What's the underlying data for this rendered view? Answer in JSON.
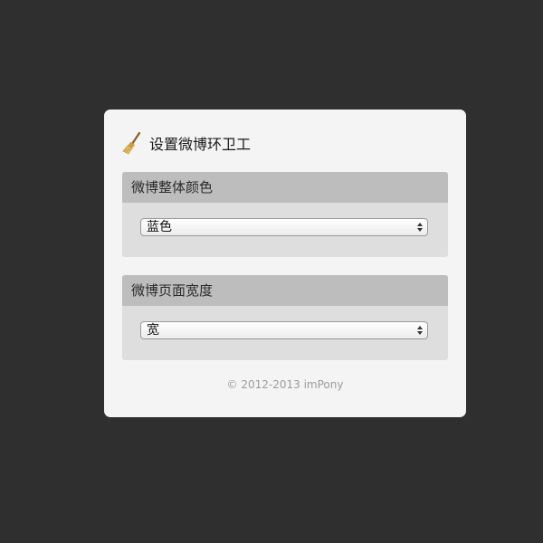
{
  "window": {
    "title": "设置微博环卫工",
    "icon": "broom-icon"
  },
  "sections": [
    {
      "heading": "微博整体颜色",
      "selected": "蓝色"
    },
    {
      "heading": "微博页面宽度",
      "selected": "宽"
    }
  ],
  "footer": {
    "copyright": "© 2012-2013 imPony"
  },
  "colors": {
    "background": "#2f2f2f",
    "dialog": "#f4f4f4",
    "section_header": "#bdbdbd",
    "section_body": "#dedede"
  }
}
